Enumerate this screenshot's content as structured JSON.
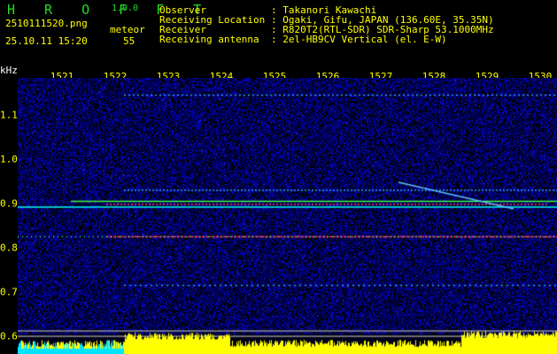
{
  "app": {
    "name": "H R O F F T",
    "version": "1.0.0"
  },
  "file": {
    "name": "2510111520.png",
    "datetime": "25.10.11 15:20"
  },
  "meteor": {
    "label": "meteor",
    "count": "55"
  },
  "info": [
    {
      "label": "Observer",
      "value": ": Takanori Kawachi"
    },
    {
      "label": "Receiving Location",
      "value": ": Ogaki, Gifu, JAPAN (136.60E, 35.35N)"
    },
    {
      "label": "Receiver",
      "value": ": R820T2(RTL-SDR) SDR-Sharp 53.1000MHz"
    },
    {
      "label": "Receiving antenna",
      "value": ": 2el-HB9CV Vertical (el. E-W)"
    }
  ],
  "axis": {
    "unit": "kHz",
    "x_ticks": [
      "1521",
      "1522",
      "1523",
      "1524",
      "1525",
      "1526",
      "1527",
      "1528",
      "1529",
      "1530"
    ],
    "y_ticks": [
      "1.1",
      "1.0",
      "0.9",
      "0.8",
      "0.7",
      "0.6"
    ]
  },
  "colors": {
    "title": "#22dd22",
    "text": "#ffff00",
    "noise": "#0a0a90",
    "bars": "#ffff00",
    "bars_low": "#00e5ff"
  }
}
